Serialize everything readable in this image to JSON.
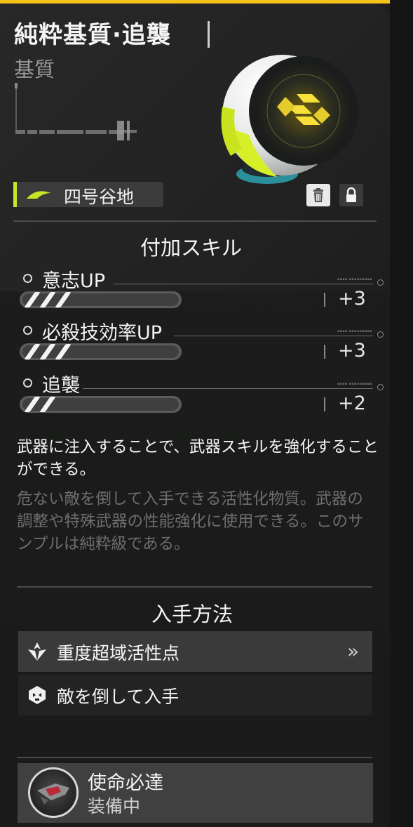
{
  "header": {
    "title": "純粋基質·追襲",
    "subtitle": "基質"
  },
  "location": {
    "label": "四号谷地",
    "accent_color": "#c8e625"
  },
  "actions": {
    "trash_icon": "trash-icon",
    "lock_icon": "lock-icon"
  },
  "skills_section": {
    "heading": "付加スキル",
    "skills": [
      {
        "name": "意志UP",
        "value": "+3",
        "level": 3
      },
      {
        "name": "必殺技効率UP",
        "value": "+3",
        "level": 3
      },
      {
        "name": "追襲",
        "value": "+2",
        "level": 2
      }
    ]
  },
  "description": {
    "main": "武器に注入することで、武器スキルを強化することができる。",
    "lore": "危ない敵を倒して入手できる活性化物質。武器の調整や特殊武器の性能強化に使用できる。このサンプルは純粋級である。"
  },
  "acquisition": {
    "heading": "入手方法",
    "methods": [
      {
        "label": "重度超域活性点",
        "icon": "diamond-emblem-icon",
        "chevron": "»"
      },
      {
        "label": "敵を倒して入手",
        "icon": "enemy-crest-icon"
      }
    ]
  },
  "equipped": {
    "name": "使命必達",
    "status": "装備中"
  },
  "colors": {
    "accent_yellow": "#f5c21a",
    "lime": "#c8e625",
    "panel_bg": "#1e1f1e"
  }
}
